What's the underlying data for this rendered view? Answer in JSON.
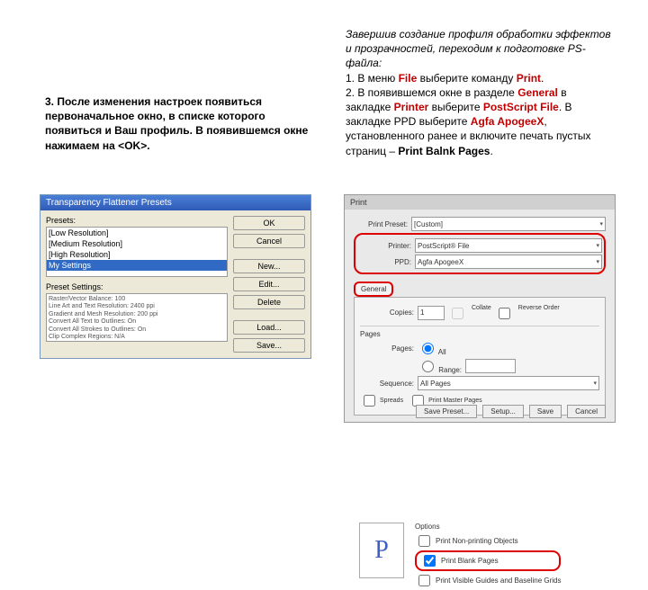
{
  "left_text": {
    "p1": "3. После изменения настроек появиться первоначальное окно, в списке которого появиться и Ваш профиль. В появившемся окне нажимаем на <OK>."
  },
  "right_text": {
    "line1": "Завершив создание профиля обработки эффектов и прозрачностей, переходим к подготовке PS-файла:",
    "l2a": " 1. В меню ",
    "file": "File",
    "l2b": " выберите команду ",
    "print": "Print",
    "period": ".",
    "l3a": " 2. В появившемся окне в разделе ",
    "general": "General",
    "l3b": " в закладке ",
    "printer": "Printer",
    "l3c": " выберите ",
    "postscript": "PostScript File",
    "l3d": ". В закладке PPD выберите ",
    "agfa": "Agfa ApogeeX",
    "l3e": ", установленного ранее и включите печать пустых страниц – ",
    "blank": "Print Balnk Pages",
    "period2": "."
  },
  "dlg1": {
    "title": "Transparency Flattener Presets",
    "presets_label": "Presets:",
    "items": {
      "0": "[Low Resolution]",
      "1": "[Medium Resolution]",
      "2": "[High Resolution]",
      "3": "My Settings"
    },
    "buttons": {
      "ok": "OK",
      "cancel": "Cancel",
      "new": "New...",
      "edit": "Edit...",
      "delete": "Delete",
      "load": "Load...",
      "save": "Save..."
    },
    "ps_label": "Preset Settings:",
    "ps_text": "Raster/Vector Balance: 100\nLine Art and Text Resolution: 2400 ppi\nGradient and Mesh Resolution: 200 ppi\nConvert All Text to Outlines: On\nConvert All Strokes to Outlines: On\nClip Complex Regions: N/A"
  },
  "dlg2": {
    "title": "Print",
    "preset_label": "Print Preset:",
    "preset_value": "[Custom]",
    "printer_label": "Printer:",
    "printer_value": "PostScript® File",
    "ppd_label": "PPD:",
    "ppd_value": "Agfa ApogeeX",
    "tab_general": "General",
    "toprow": {
      "copies": "Copies:",
      "copies_val": "1",
      "collate": "Collate",
      "reverse": "Reverse Order"
    },
    "pages": {
      "label": "Pages",
      "pages_lbl": "Pages:",
      "all": "All",
      "range": "Range:",
      "seq_lbl": "Sequence:",
      "seq_val": "All Pages",
      "spreads": "Spreads",
      "master": "Print Master Pages"
    },
    "options": {
      "label": "Options",
      "nonprint": "Print Non-printing Objects",
      "blank": "Print Blank Pages",
      "guides": "Print Visible Guides and Baseline Grids"
    },
    "foot": {
      "save_preset": "Save Preset...",
      "setup": "Setup...",
      "save": "Save",
      "cancel": "Cancel"
    },
    "preview_glyph": "P"
  }
}
